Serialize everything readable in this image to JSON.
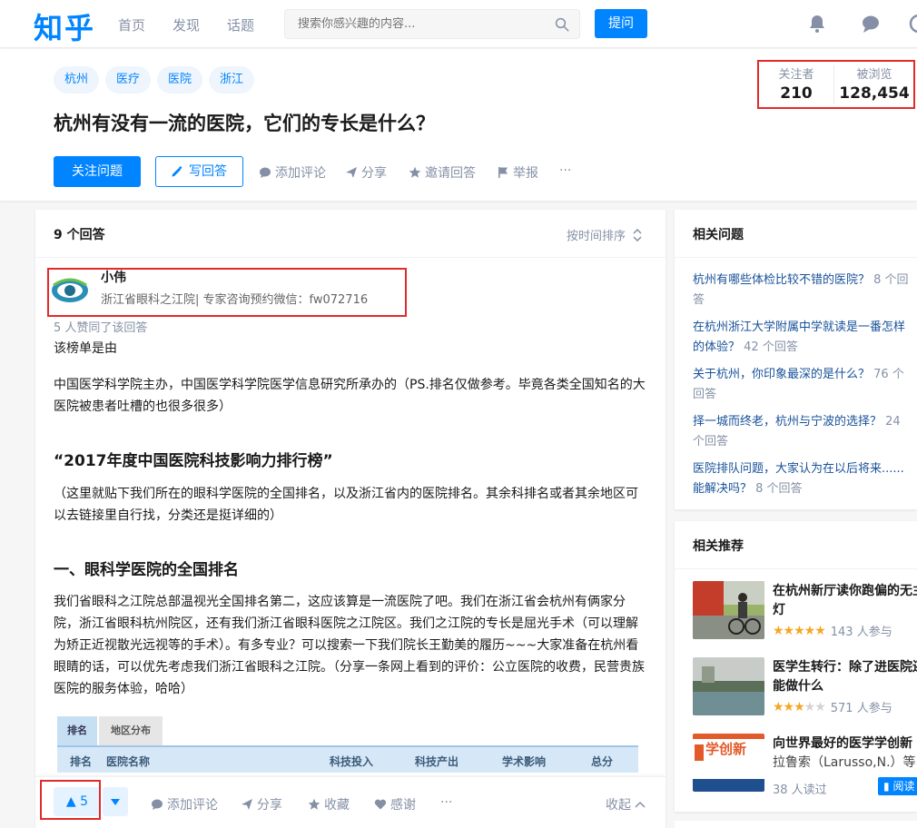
{
  "header": {
    "logo": "知乎",
    "nav": [
      "首页",
      "发现",
      "话题"
    ],
    "search_placeholder": "搜索你感兴趣的内容...",
    "ask_label": "提问"
  },
  "question": {
    "topics": [
      "杭州",
      "医疗",
      "医院",
      "浙江"
    ],
    "title": "杭州有没有一流的医院，它们的专长是什么？",
    "follow_label": "关注问题",
    "write_label": "写回答",
    "actions": [
      "添加评论",
      "分享",
      "邀请回答",
      "举报",
      "···"
    ],
    "followers_label": "关注者",
    "followers": "210",
    "views_label": "被浏览",
    "views": "128,454"
  },
  "answers": {
    "count_label": "9 个回答",
    "sort_label": "按时间排序",
    "author_name": "小伟",
    "author_bio": "浙江省眼科之江院| 专家咨询预约微信：fw072716",
    "votes_text": "5 人赞同了该回答",
    "p1": "该榜单是由",
    "p2": "中国医学科学院主办，中国医学科学院医学信息研究所承办的（PS.排名仅做参考。毕竟各类全国知名的大医院被患者吐槽的也很多很多）",
    "h1": "“2017年度中国医院科技影响力排行榜”",
    "p3": "（这里就贴下我们所在的眼科学医院的全国排名，以及浙江省内的医院排名。其余科排名或者其余地区可以去链接里自行找，分类还是挺详细的）",
    "h2": "一、眼科学医院的全国排名",
    "p4": "我们省眼科之江院总部温视光全国排名第二，这应该算是一流医院了吧。我们在浙江省会杭州有俩家分院，浙江省眼科杭州院区，还有我们浙江省眼科医院之江院区。我们之江院的专长是屈光手术（可以理解为矫正近视散光远视等的手术）。有多专业？可以搜索一下我们院长王勤美的履历~~~大家准备在杭州看眼睛的话，可以优先考虑我们浙江省眼科之江院。（分享一条网上看到的评价：公立医院的收费，民营贵族医院的服务体验，哈哈）",
    "table_tabs": [
      "排名",
      "地区分布"
    ],
    "table_headers": [
      "排名",
      "医院名称",
      "科技投入",
      "科技产出",
      "学术影响",
      "总分"
    ],
    "vote_count": "5",
    "bottom_actions": [
      "添加评论",
      "分享",
      "收藏",
      "感谢",
      "···"
    ],
    "collapse_label": "收起"
  },
  "sidebar": {
    "related_title": "相关问题",
    "related": [
      {
        "l1": "杭州有哪些体检比较不错的医院？",
        "c1": " 8 个回",
        "l2": "",
        "c2": "答"
      },
      {
        "l1": "在杭州浙江大学附属中学就读是一番怎样",
        "c1": "",
        "l2": "的体验？",
        "c2": " 42 个回答"
      },
      {
        "l1": "关于杭州，你印象最深的是什么？",
        "c1": " 76 个",
        "l2": "",
        "c2": "回答"
      },
      {
        "l1": "择一城而终老，杭州与宁波的选择？",
        "c1": " 24",
        "l2": "",
        "c2": "个回答"
      },
      {
        "l1": "医院排队问题，大家认为在以后将来......",
        "c1": "",
        "l2": "能解决吗？",
        "c2": " 8 个回答"
      }
    ],
    "rec_title": "相关推荐",
    "recs": [
      {
        "l1": "在杭州新厅读你跑偏的无主",
        "l2": "灯",
        "meta": "143 人参与"
      },
      {
        "l1": "医学生转行：除了进医院还",
        "l2": "能做什么",
        "meta": "571 人参与"
      },
      {
        "l1": "向世界最好的医学学创新",
        "l2": "拉鲁索（Larusso,N.）等",
        "meta": "38 人读过"
      }
    ],
    "read_label": "阅读",
    "book_cover_text": "学创新"
  }
}
